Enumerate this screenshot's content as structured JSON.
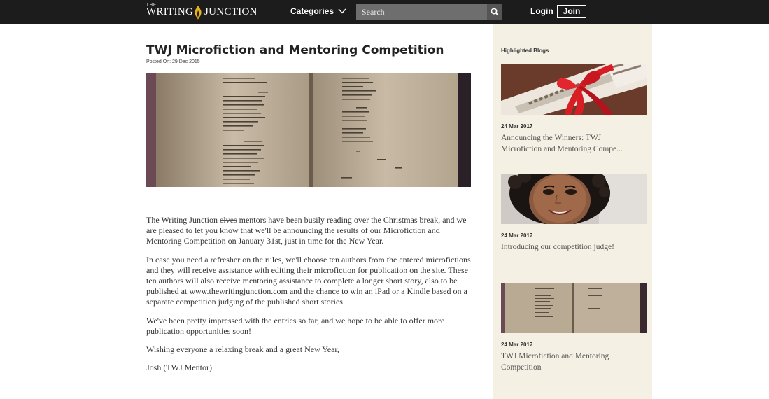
{
  "header": {
    "logo_small": "THE",
    "logo_word1": "WRITING",
    "logo_word2": "JUNCTION",
    "categories_label": "Categories",
    "search_placeholder": "Search",
    "login_label": "Login",
    "join_label": "Join"
  },
  "article": {
    "title": "TWJ Microfiction and Mentoring Competition",
    "posted": "Posted On: 29 Dec 2015",
    "p1_before": "The Writing Junction ",
    "p1_strike": "elves",
    "p1_after": " mentors have been busily reading over the Christmas break, and we are pleased to let you know that we'll be announcing the results of our Microfiction and Mentoring Competition on January 31st, just in time for the New Year.",
    "p2": "In case you need a refresher on the rules, we'll choose ten authors from the entered microfictions and they will receive assistance with editing their microfiction for publication on the site. These ten authors will also receive mentoring assistance to complete a longer short story, also to be published at www.thewritingjunction.com and the chance to win an iPad or a Kindle based on a separate competition judging of the published short stories.",
    "p3": "We've been pretty impressed with the entries so far, and we hope to be able to offer more publication opportunities soon!",
    "p4": "Wishing everyone a relaxing break and a great New Year,",
    "p5": "Josh (TWJ Mentor)"
  },
  "sidebar": {
    "heading": "Highlighted Blogs",
    "items": [
      {
        "date": "24 Mar 2017",
        "title": "Announcing the Winners: TWJ Microfiction and Mentoring Compe..."
      },
      {
        "date": "24 Mar 2017",
        "title": "Introducing our competition judge!"
      },
      {
        "date": "24 Mar 2017",
        "title": "TWJ Microfiction and Mentoring Competition"
      }
    ]
  },
  "colors": {
    "topbar": "#1c1c1c",
    "sidebar_bg": "#f4f0e4",
    "search_bg": "#6e6e6e",
    "ribbon_red": "#d81e25"
  },
  "icons": [
    "flame-logo-icon",
    "chevron-down-icon",
    "search-icon"
  ]
}
